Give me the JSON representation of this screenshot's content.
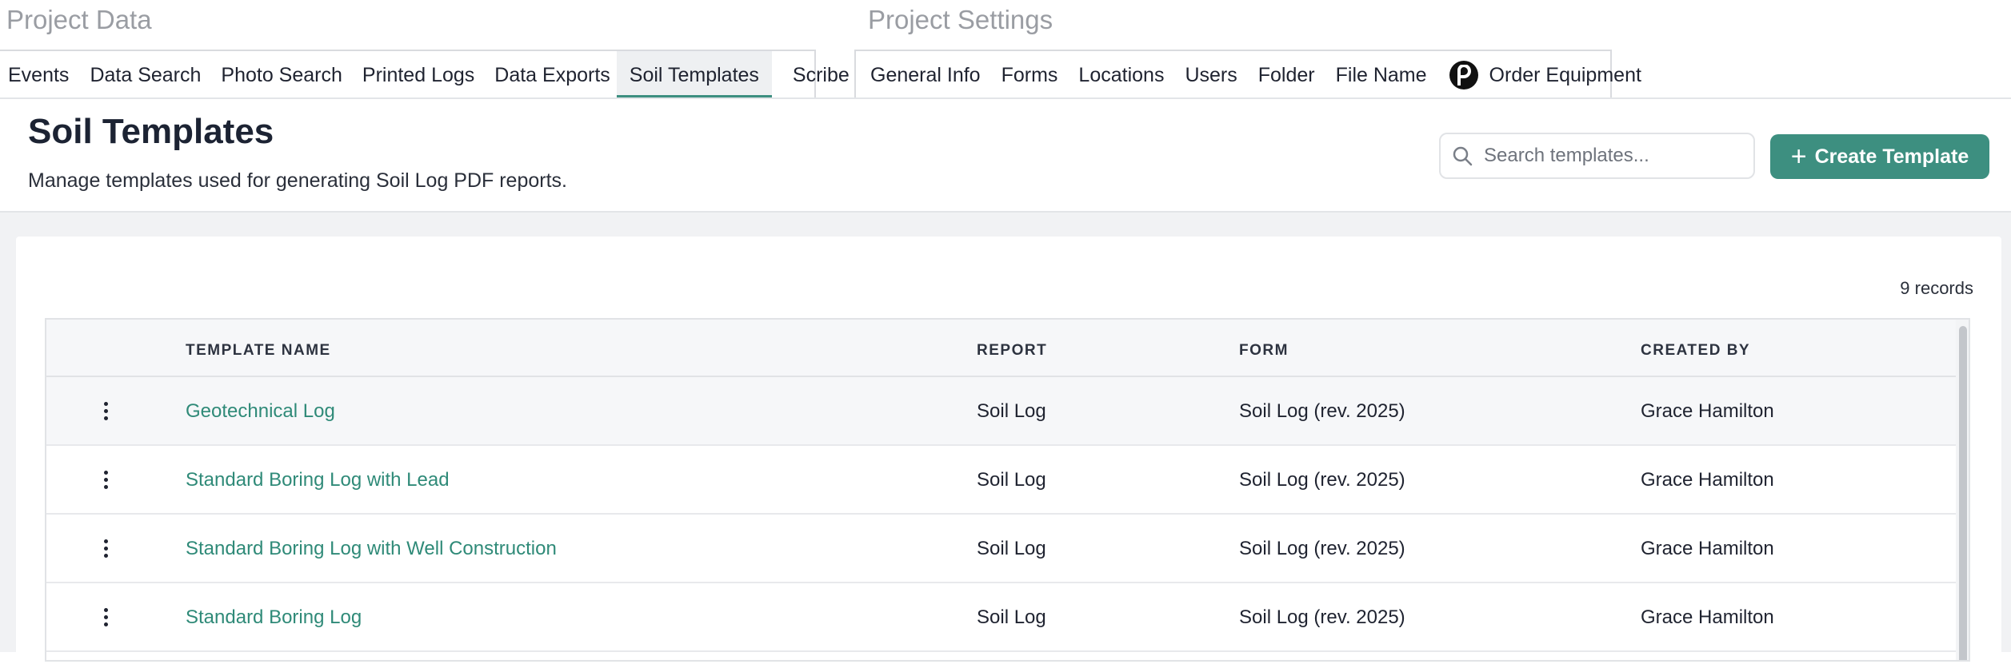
{
  "nav": {
    "project_data_title": "Project Data",
    "project_settings_title": "Project Settings",
    "project_data_tabs": [
      "Events",
      "Data Search",
      "Photo Search",
      "Printed Logs",
      "Data Exports",
      "Soil Templates",
      "Scribe"
    ],
    "active_tab": "Soil Templates",
    "project_settings_tabs": [
      "General Info",
      "Forms",
      "Locations",
      "Users",
      "Folder",
      "File Name",
      "Order Equipment"
    ],
    "order_equipment_icon": "brand-p-icon"
  },
  "header": {
    "title": "Soil Templates",
    "subtitle": "Manage templates used for generating Soil Log PDF reports.",
    "search_placeholder": "Search templates...",
    "create_label": "Create Template"
  },
  "table": {
    "records_label": "9 records",
    "columns": [
      "TEMPLATE NAME",
      "REPORT",
      "FORM",
      "CREATED BY"
    ],
    "rows": [
      {
        "name": "Geotechnical Log",
        "report": "Soil Log",
        "form": "Soil Log (rev. 2025)",
        "created_by": "Grace Hamilton"
      },
      {
        "name": "Standard Boring Log with Lead",
        "report": "Soil Log",
        "form": "Soil Log (rev. 2025)",
        "created_by": "Grace Hamilton"
      },
      {
        "name": "Standard Boring Log with Well Construction",
        "report": "Soil Log",
        "form": "Soil Log (rev. 2025)",
        "created_by": "Grace Hamilton"
      },
      {
        "name": "Standard Boring Log",
        "report": "Soil Log",
        "form": "Soil Log (rev. 2025)",
        "created_by": "Grace Hamilton"
      }
    ]
  },
  "colors": {
    "accent": "#3d8f80",
    "link": "#2f8a78",
    "muted_title": "#9a9da3"
  }
}
